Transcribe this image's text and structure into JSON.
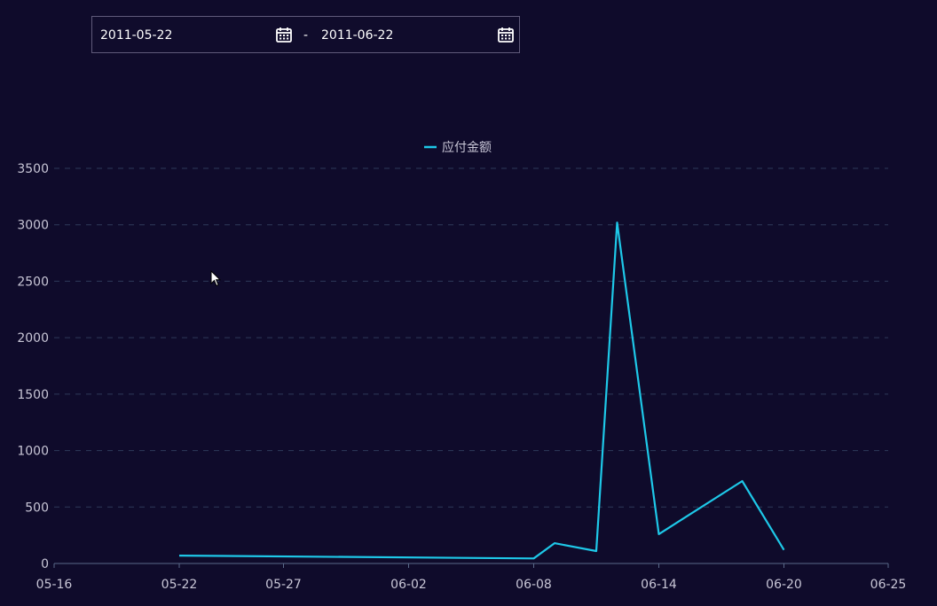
{
  "date_range": {
    "start": "2011-05-22",
    "separator": "-",
    "end": "2011-06-22",
    "start_icon": "calendar-icon",
    "end_icon": "calendar-icon"
  },
  "colors": {
    "background": "#0f0b2b",
    "series": "#1ec8e8",
    "grid": "#2e3a5a",
    "axis": "#5a6a8a",
    "text": "#c8c6d6"
  },
  "chart_data": {
    "type": "line",
    "title": "",
    "xlabel": "",
    "ylabel": "",
    "legend_position": "top-center",
    "grid": true,
    "x_range": [
      "2011-05-16",
      "2011-06-25"
    ],
    "x_ticks": [
      "05-16",
      "05-22",
      "05-27",
      "06-02",
      "06-08",
      "06-14",
      "06-20",
      "06-25"
    ],
    "ylim": [
      0,
      3500
    ],
    "y_ticks": [
      0,
      500,
      1000,
      1500,
      2000,
      2500,
      3000,
      3500
    ],
    "series": [
      {
        "name": "应付金额",
        "color": "#1ec8e8",
        "points": [
          {
            "x": "2011-05-22",
            "y": 70
          },
          {
            "x": "2011-06-08",
            "y": 45
          },
          {
            "x": "2011-06-09",
            "y": 180
          },
          {
            "x": "2011-06-11",
            "y": 110
          },
          {
            "x": "2011-06-12",
            "y": 3020
          },
          {
            "x": "2011-06-14",
            "y": 260
          },
          {
            "x": "2011-06-18",
            "y": 730
          },
          {
            "x": "2011-06-20",
            "y": 120
          }
        ]
      }
    ]
  }
}
